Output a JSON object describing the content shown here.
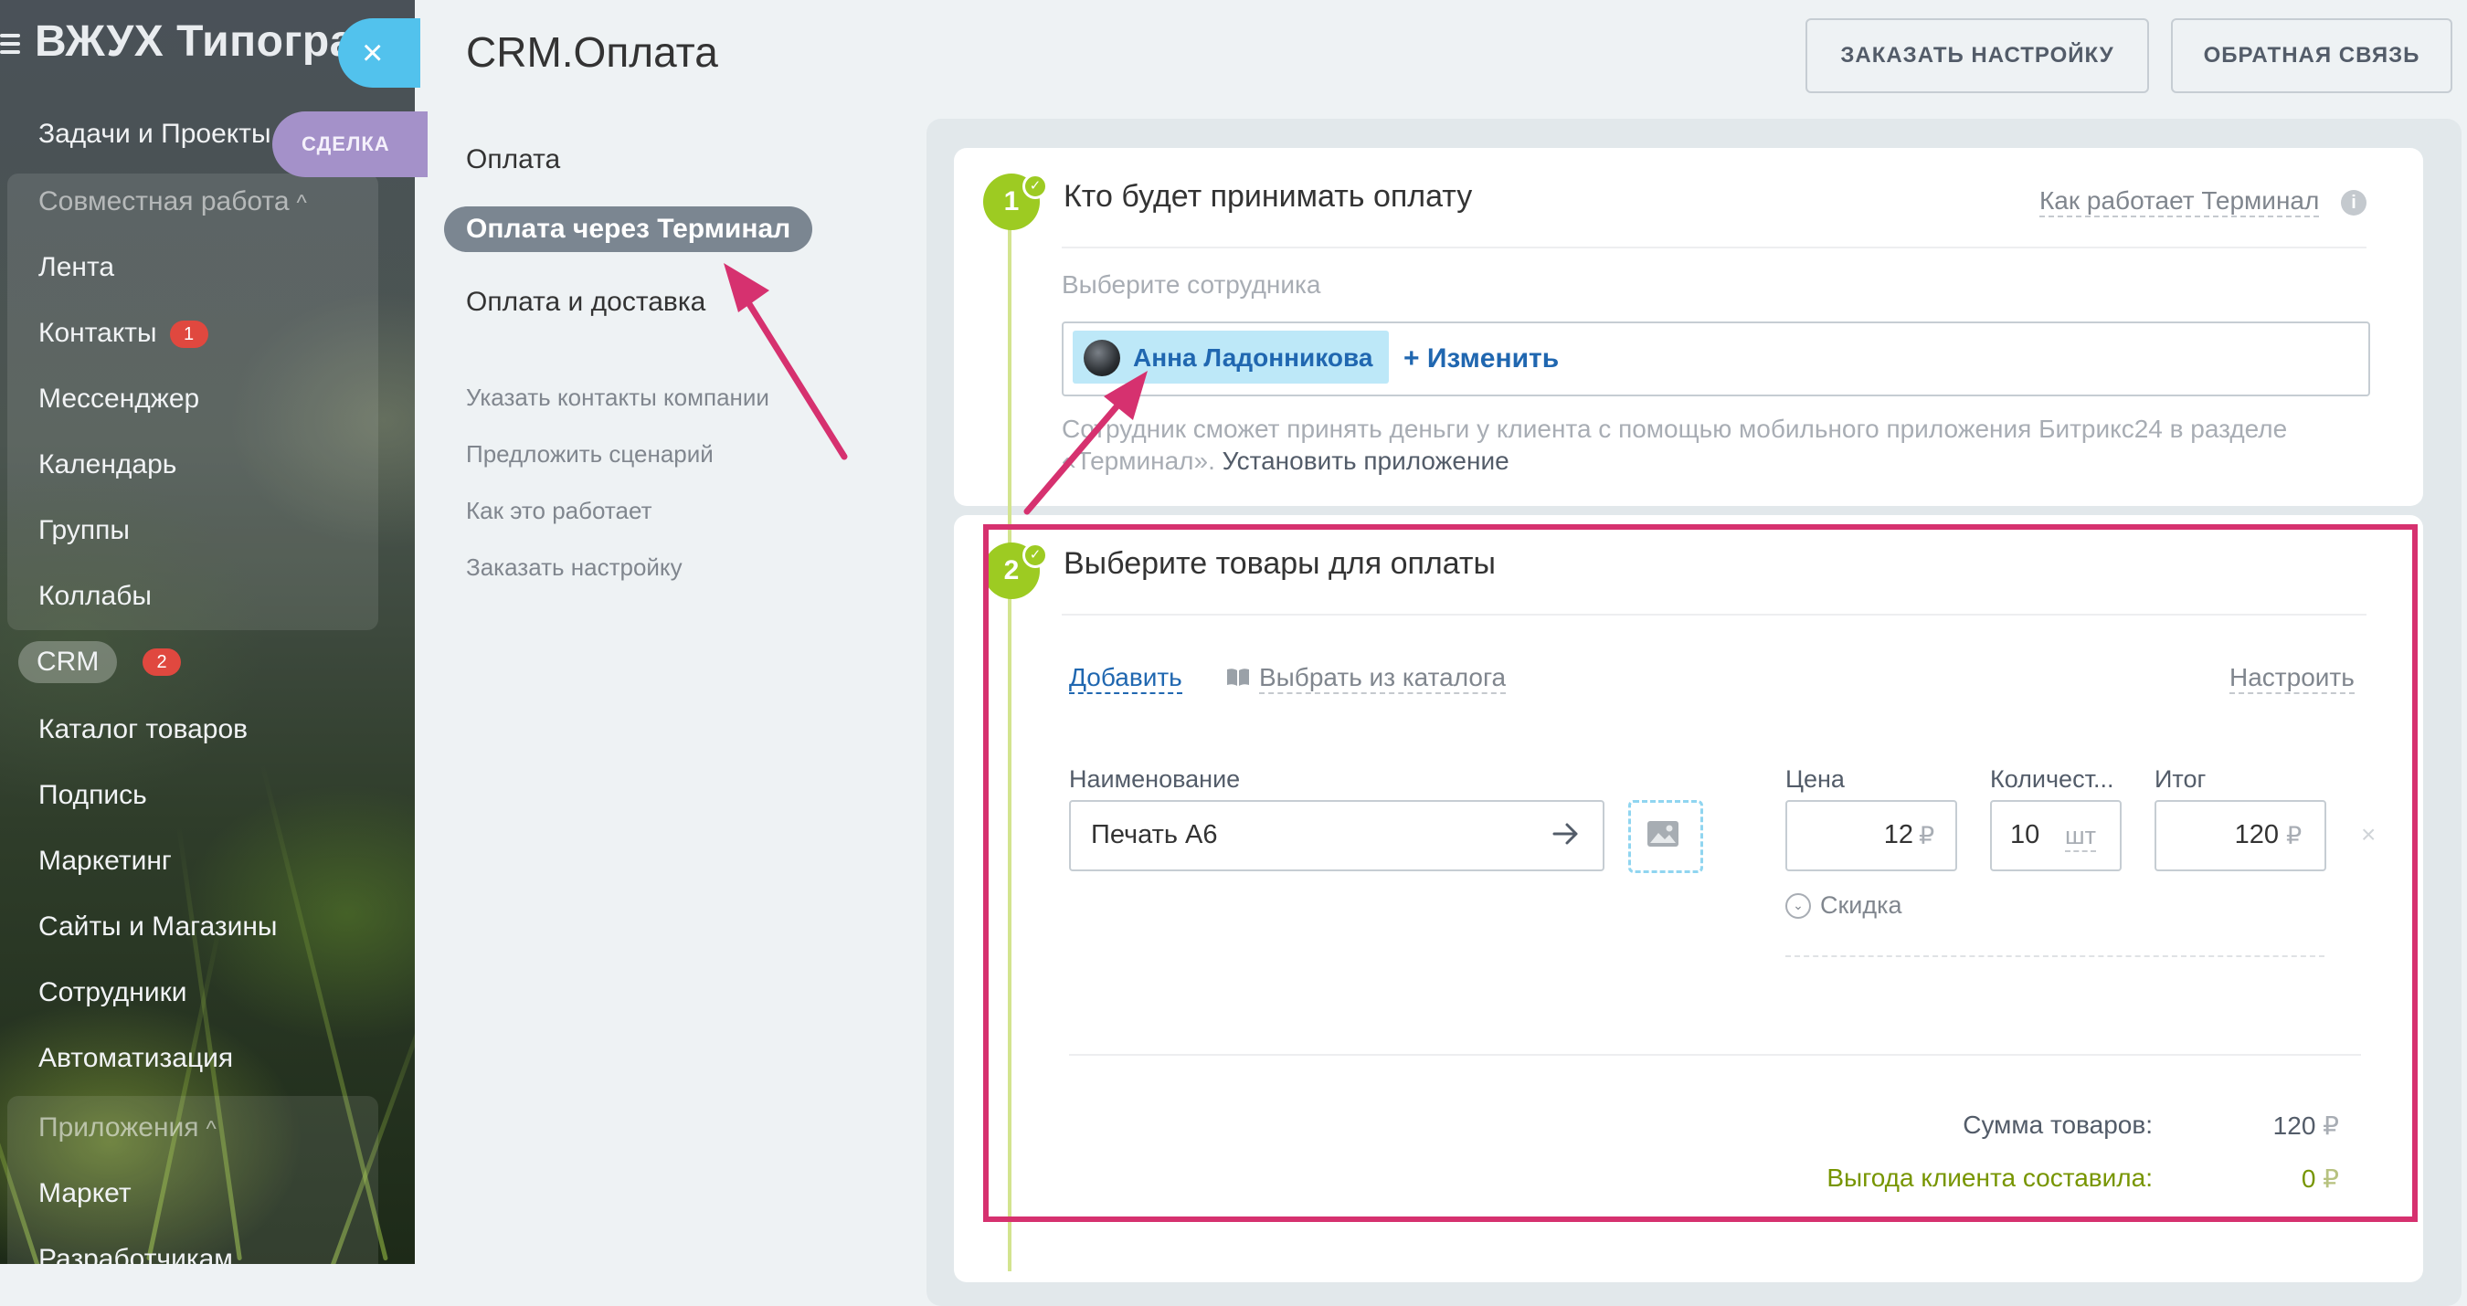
{
  "sidebar": {
    "title": "ВЖУХ Типогра",
    "close_symbol": "×",
    "deal_tab": "СДЕЛКА",
    "items": [
      {
        "label": "Задачи и Проекты"
      },
      {
        "label": "Совместная работа",
        "chevron": "^"
      },
      {
        "label": "Лента"
      },
      {
        "label": "Контакты",
        "counter": "1"
      },
      {
        "label": "Мессенджер"
      },
      {
        "label": "Календарь"
      },
      {
        "label": "Группы"
      },
      {
        "label": "Коллабы"
      },
      {
        "label": "CRM",
        "counter": "2"
      },
      {
        "label": "Каталог товаров"
      },
      {
        "label": "Подпись"
      },
      {
        "label": "Маркетинг"
      },
      {
        "label": "Сайты и Магазины"
      },
      {
        "label": "Сотрудники"
      },
      {
        "label": "Автоматизация"
      },
      {
        "label": "Приложения",
        "chevron": "^"
      },
      {
        "label": "Маркет"
      },
      {
        "label": "Разработчикам"
      }
    ]
  },
  "header": {
    "title": "CRM.Оплата",
    "order_setup_button": "ЗАКАЗАТЬ НАСТРОЙКУ",
    "feedback_button": "ОБРАТНАЯ СВЯЗЬ"
  },
  "nav": {
    "items": [
      "Оплата",
      "Оплата через Терминал",
      "Оплата и доставка"
    ],
    "active_index": 1,
    "links": [
      "Указать контакты компании",
      "Предложить сценарий",
      "Как это работает",
      "Заказать настройку"
    ]
  },
  "step1": {
    "number": "1",
    "title": "Кто будет принимать оплату",
    "how_link": "Как работает Терминал",
    "info_symbol": "i",
    "hint": "Выберите сотрудника",
    "employee": "Анна Ладонникова",
    "change_link": "+ Изменить",
    "description": "Сотрудник сможет принять деньги у клиента с помощью мобильного приложения Битрикс24 в разделе «Терминал».",
    "install_link": "Установить приложение"
  },
  "step2": {
    "number": "2",
    "title": "Выберите товары для оплаты",
    "add_link": "Добавить",
    "catalog_link": "Выбрать из каталога",
    "configure_link": "Настроить",
    "columns": {
      "name": "Наименование",
      "price": "Цена",
      "quantity": "Количест...",
      "total": "Итог"
    },
    "product": {
      "name": "Печать А6",
      "price": "12",
      "quantity": "10",
      "unit": "шт",
      "total": "120",
      "currency": "₽"
    },
    "discount_label": "Скидка",
    "sum_label": "Сумма товаров:",
    "sum_value": "120",
    "benefit_label": "Выгода клиента составила:",
    "benefit_value": "0",
    "currency": "₽"
  },
  "colors": {
    "accent": "#2067b0",
    "step_green": "#9dcb22",
    "annotation": "#d6316f",
    "active_nav": "#7b8691"
  }
}
